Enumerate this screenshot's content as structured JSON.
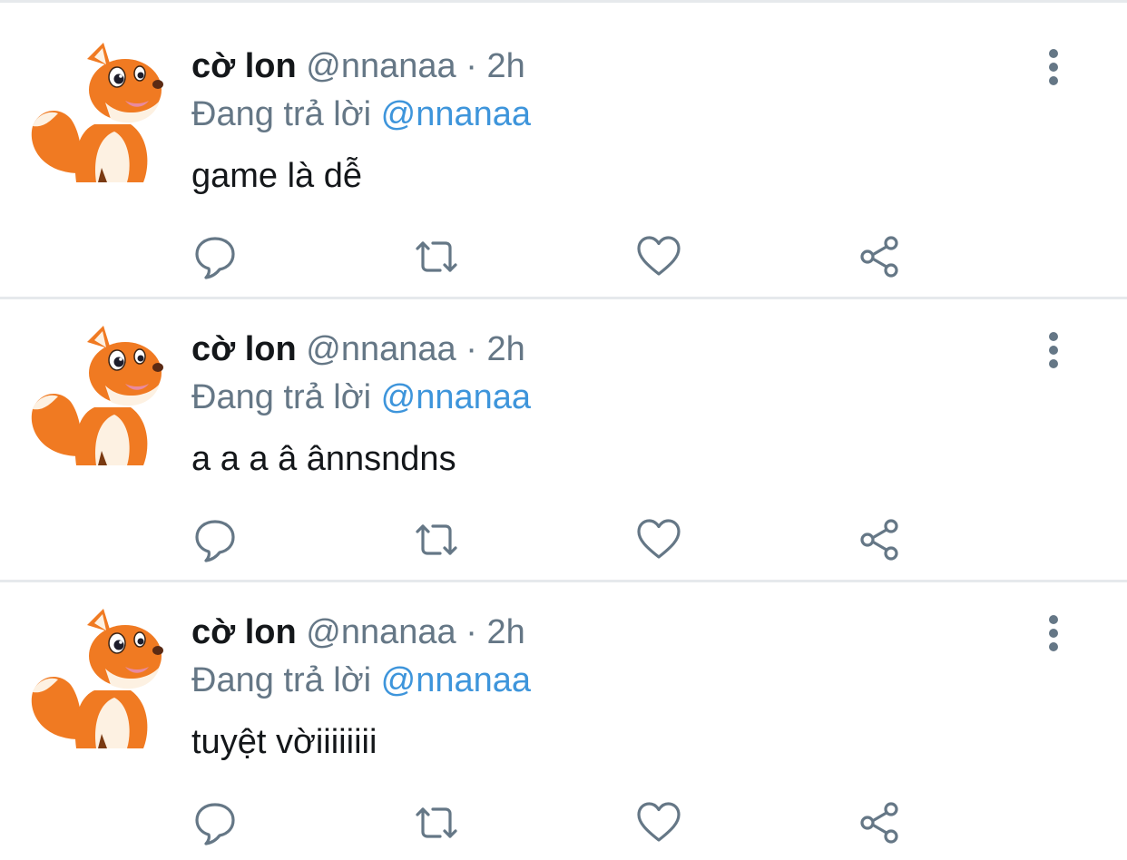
{
  "colors": {
    "divider": "#e6e9ec",
    "name": "#14171a",
    "secondary": "#657786",
    "mention": "#3e95db",
    "icon": "#657786",
    "fox_orange": "#f07a22",
    "fox_cream": "#fdf1e2"
  },
  "icons": {
    "avatar": "fox-avatar",
    "more": "vertical-ellipsis-icon",
    "reply": "speech-bubble-icon",
    "retweet": "retweet-arrows-icon",
    "like": "heart-icon",
    "share": "share-nodes-icon"
  },
  "tweets": [
    {
      "display_name": "cờ lon",
      "handle": "@nnanaa",
      "separator": "·",
      "time": "2h",
      "replying_to_label": "Đang trả lời",
      "replying_to_handle": "@nnanaa",
      "text": "game là dễ"
    },
    {
      "display_name": "cờ lon",
      "handle": "@nnanaa",
      "separator": "·",
      "time": "2h",
      "replying_to_label": "Đang trả lời",
      "replying_to_handle": "@nnanaa",
      "text": "a a a â ânnsndns"
    },
    {
      "display_name": "cờ lon",
      "handle": "@nnanaa",
      "separator": "·",
      "time": "2h",
      "replying_to_label": "Đang trả lời",
      "replying_to_handle": "@nnanaa",
      "text": "tuyệt vờiiiiiiii"
    }
  ]
}
